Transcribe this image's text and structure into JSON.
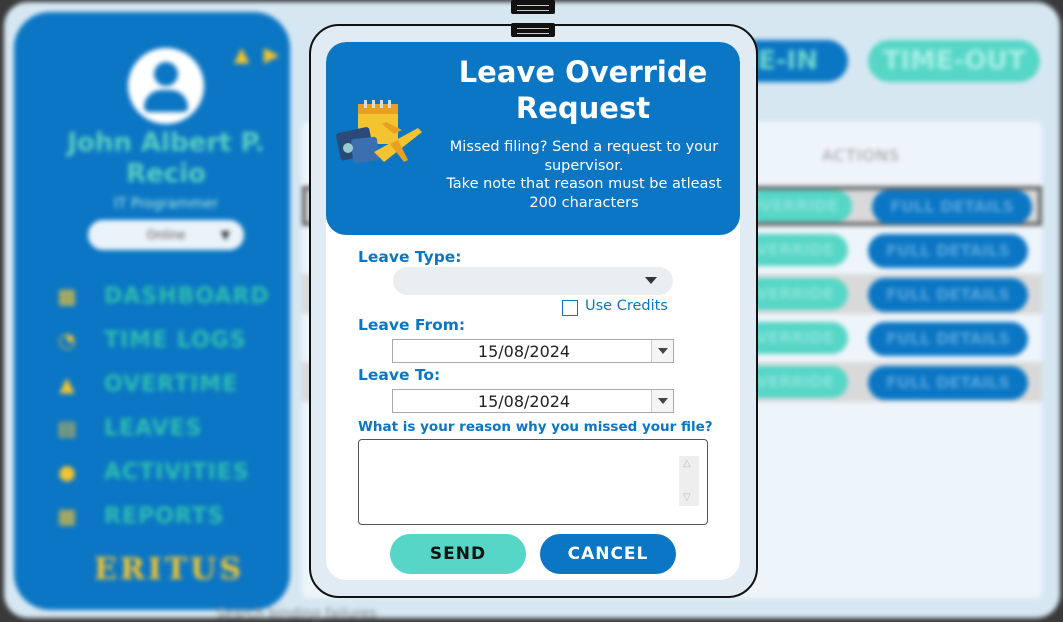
{
  "background": {
    "user": {
      "name": "John Albert P. Recio",
      "role": "IT Programmer",
      "status": "Online"
    },
    "nav": [
      {
        "label": "DASHBOARD",
        "icon": "chart-icon"
      },
      {
        "label": "TIME LOGS",
        "icon": "clock-icon"
      },
      {
        "label": "OVERTIME",
        "icon": "overtime-icon"
      },
      {
        "label": "LEAVES",
        "icon": "leave-icon"
      },
      {
        "label": "ACTIVITIES",
        "icon": "activities-icon"
      },
      {
        "label": "REPORTS",
        "icon": "reports-icon"
      }
    ],
    "brand": "ERITUS",
    "time_in_label": "TIME-IN",
    "time_out_label": "TIME-OUT",
    "actions_header": "ACTIONS",
    "override_label": "OVERRIDE",
    "details_label": "FULL DETAILS",
    "bottom_text": "Search binding failures"
  },
  "modal": {
    "title": "Leave Override Request",
    "subtitle_line1": "Missed filing? Send a request to your supervisor.",
    "subtitle_line2": "Take note that reason must be atleast 200 characters",
    "leave_type_label": "Leave Type:",
    "leave_type_value": "",
    "use_credits_label": "Use Credits",
    "use_credits_checked": false,
    "leave_from_label": "Leave From:",
    "leave_from_value": "15/08/2024",
    "leave_to_label": "Leave To:",
    "leave_to_value": "15/08/2024",
    "reason_label": "What is your reason why you missed your file?",
    "reason_value": "",
    "send_label": "SEND",
    "cancel_label": "CANCEL"
  },
  "colors": {
    "primary": "#0b76c4",
    "accent": "#56d6c6",
    "gold": "#f4c430"
  }
}
